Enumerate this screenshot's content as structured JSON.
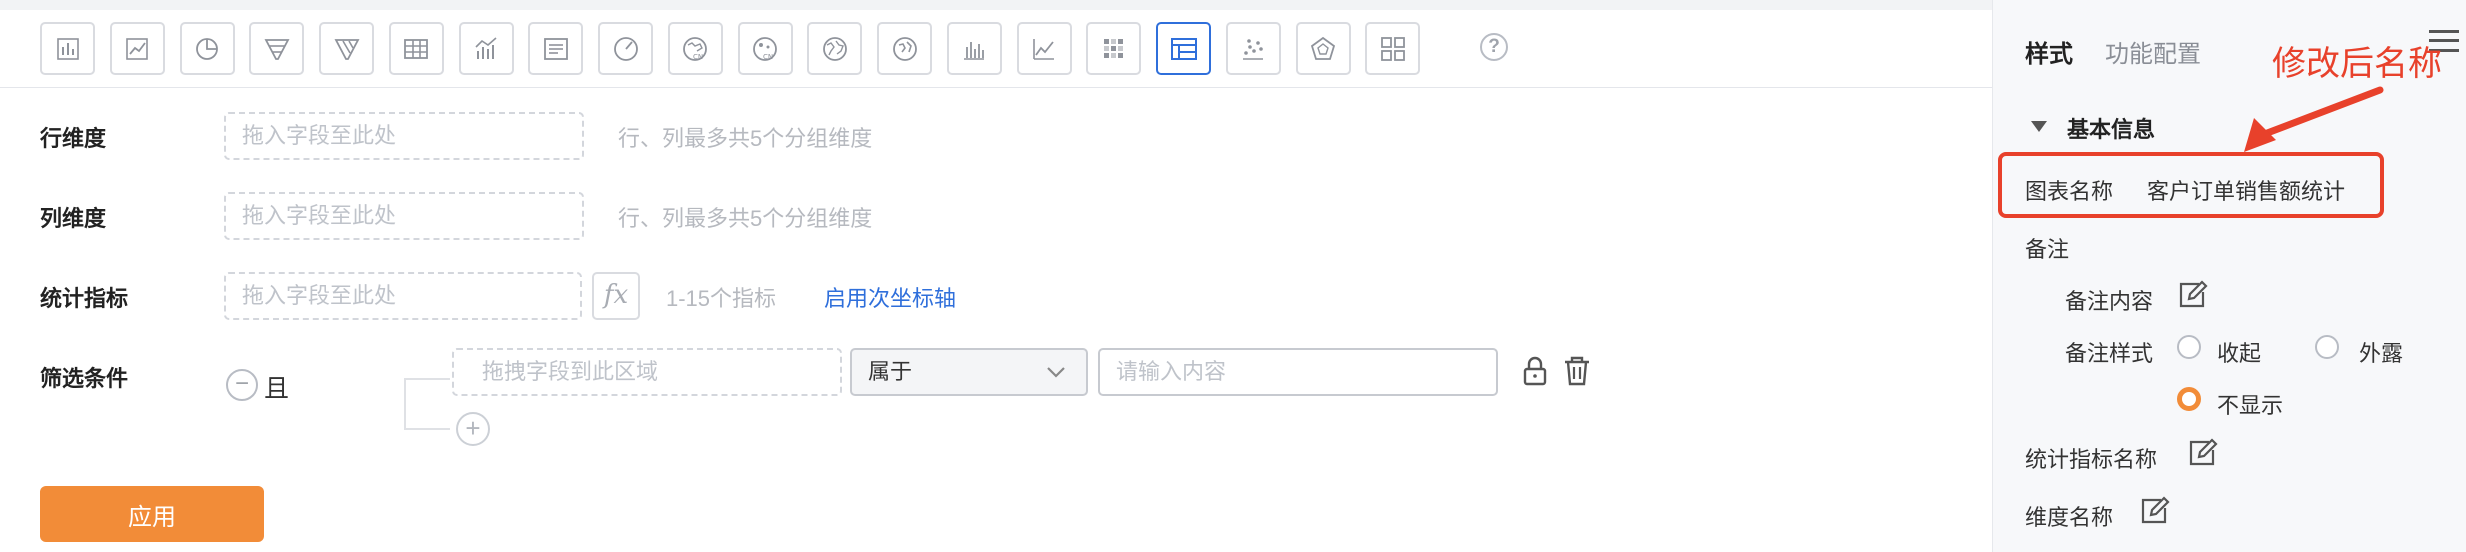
{
  "toolbar": {
    "chart_types": [
      "bar",
      "line",
      "pie",
      "funnel",
      "funnel-alt",
      "table",
      "combo",
      "text",
      "gauge",
      "map-cn",
      "map-cn-bubble",
      "world-map",
      "globe",
      "column",
      "trend",
      "heatmap",
      "pivot-table",
      "scatter",
      "radar",
      "dashboard-grid"
    ],
    "active_index": 16,
    "help_label": "?"
  },
  "editor": {
    "rows": {
      "label": "行维度",
      "placeholder": "拖入字段至此处",
      "hint": "行、列最多共5个分组维度"
    },
    "columns": {
      "label": "列维度",
      "placeholder": "拖入字段至此处",
      "hint": "行、列最多共5个分组维度"
    },
    "metrics": {
      "label": "统计指标",
      "placeholder": "拖入字段至此处",
      "fx_label": "fx",
      "hint": "1-15个指标",
      "secondary_axis_link": "启用次坐标轴"
    },
    "filters": {
      "label": "筛选条件",
      "logic_label": "且",
      "drop_placeholder": "拖拽字段到此区域",
      "operator_value": "属于",
      "value_placeholder": "请输入内容"
    },
    "apply_label": "应用"
  },
  "panel": {
    "tabs": [
      "样式",
      "功能配置"
    ],
    "section_title": "基本信息",
    "chart_name_label": "图表名称",
    "chart_name_value": "客户订单销售额统计",
    "note_label": "备注",
    "note_content_label": "备注内容",
    "note_style_label": "备注样式",
    "note_style_options": [
      "收起",
      "外露",
      "不显示"
    ],
    "note_style_selected": "不显示",
    "metric_name_label": "统计指标名称",
    "dimension_name_label": "维度名称"
  },
  "annotation": {
    "label": "修改后名称",
    "color": "#e8412b"
  },
  "colors": {
    "accent_blue": "#2f6fdb",
    "apply_orange": "#f28c38"
  }
}
